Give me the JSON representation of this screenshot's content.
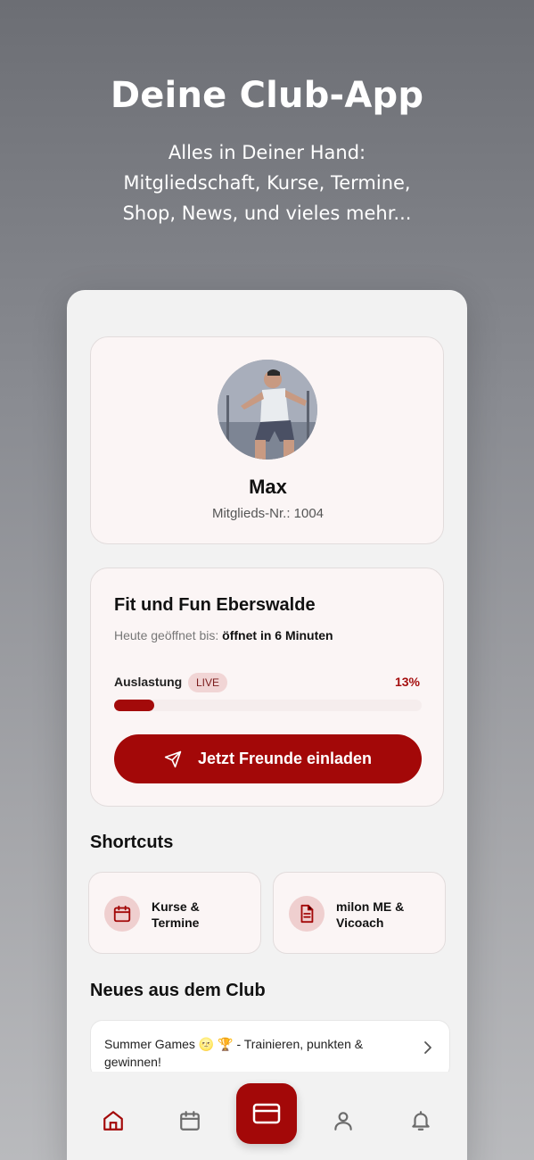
{
  "hero": {
    "title": "Deine Club-App",
    "subtitle_line1": "Alles in Deiner Hand:",
    "subtitle_line2": "Mitgliedschaft, Kurse, Termine,",
    "subtitle_line3": "Shop, News, und vieles mehr..."
  },
  "profile": {
    "name": "Max",
    "member_number": "Mitglieds-Nr.: 1004"
  },
  "club": {
    "name": "Fit und Fun Eberswalde",
    "hours_label": "Heute geöffnet bis:",
    "hours_value": "öffnet in 6 Minuten",
    "load_label": "Auslastung",
    "live_badge": "LIVE",
    "load_percent_text": "13%",
    "load_fraction": 0.13,
    "invite_button": "Jetzt Freunde einladen"
  },
  "shortcuts": {
    "title": "Shortcuts",
    "items": [
      {
        "label": "Kurse & Termine",
        "icon": "calendar-icon"
      },
      {
        "label": "milon ME & Vicoach",
        "icon": "document-icon"
      }
    ]
  },
  "news": {
    "title": "Neues aus dem Club",
    "items": [
      {
        "text": "Summer Games 🌝 🏆  - Trainieren, punkten & gewinnen!"
      }
    ]
  },
  "nav": {
    "items": [
      "home-icon",
      "calendar-icon",
      "card-icon",
      "profile-icon",
      "bell-icon"
    ],
    "active": "home-icon"
  },
  "colors": {
    "accent": "#a30808",
    "accent_light": "#efcfcf",
    "card_bg": "#fbf5f5"
  }
}
